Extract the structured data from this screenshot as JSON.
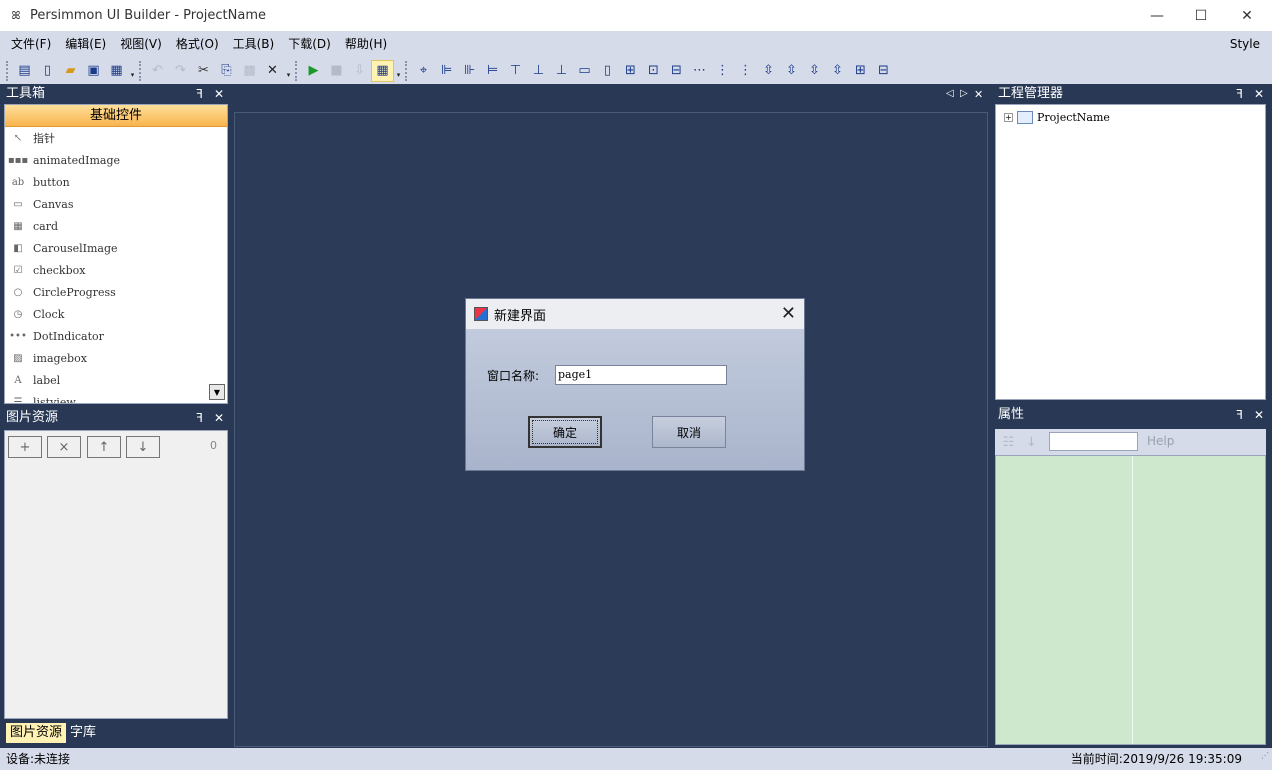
{
  "window": {
    "title": "Persimmon UI Builder - ProjectName",
    "app_icon_glyph": "ꕤ",
    "minimize_glyph": "—",
    "maximize_glyph": "☐",
    "close_glyph": "✕"
  },
  "menu": {
    "items": [
      "文件(F)",
      "编辑(E)",
      "视图(V)",
      "格式(O)",
      "工具(B)",
      "下载(D)",
      "帮助(H)"
    ],
    "style_label": "Style"
  },
  "toolbar": {
    "icons": {
      "new_page": "▤",
      "new_file": "▯",
      "open": "▰",
      "save": "▣",
      "save_all": "▦",
      "undo": "↶",
      "redo": "↷",
      "cut": "✂",
      "copy": "⎘",
      "paste": "▩",
      "delete": "✕",
      "run": "▶",
      "stop": "■",
      "download": "⇩",
      "grid": "▦",
      "drop": "▾"
    },
    "align_icons": [
      "⌖",
      "⊫",
      "⊪",
      "⊨",
      "⊤",
      "⊥",
      "⊥",
      "▭",
      "▯",
      "⊞",
      "⊡",
      "⊟",
      "⋯",
      "⋮",
      "⋮",
      "⇳",
      "⇳",
      "⇳",
      "⇳",
      "⊞",
      "⊟"
    ]
  },
  "toolbox": {
    "title": "工具箱",
    "pin_glyph": "ꟻ",
    "close_glyph": "✕",
    "header": "基础控件",
    "items": [
      {
        "label": "指针",
        "icon": "↖"
      },
      {
        "label": "animatedImage",
        "icon": "▪▪▪"
      },
      {
        "label": "button",
        "icon": "ab"
      },
      {
        "label": "Canvas",
        "icon": "▭"
      },
      {
        "label": "card",
        "icon": "▦"
      },
      {
        "label": "CarouselImage",
        "icon": "◧"
      },
      {
        "label": "checkbox",
        "icon": "☑"
      },
      {
        "label": "CircleProgress",
        "icon": "○"
      },
      {
        "label": "Clock",
        "icon": "◷"
      },
      {
        "label": "DotIndicator",
        "icon": "•••"
      },
      {
        "label": "imagebox",
        "icon": "▨"
      },
      {
        "label": "label",
        "icon": "A"
      },
      {
        "label": "listview",
        "icon": "☰"
      }
    ],
    "scroll_glyph": "▼"
  },
  "image_resources": {
    "title": "图片资源",
    "buttons": [
      "+",
      "×",
      "↑",
      "↓"
    ],
    "count": "0",
    "tabs": [
      "图片资源",
      "字库"
    ]
  },
  "document": {
    "nav_prev": "◁",
    "nav_next": "▷",
    "nav_close": "✕"
  },
  "dialog": {
    "title": "新建界面",
    "close_glyph": "✕",
    "name_label": "窗口名称:",
    "name_value": "page1",
    "ok_label": "确定",
    "cancel_label": "取消"
  },
  "project_manager": {
    "title": "工程管理器",
    "expand_glyph": "+",
    "root_node": "ProjectName"
  },
  "properties": {
    "title": "属性",
    "categorized_glyph": "☷",
    "sort_glyph": "↓",
    "help_label": "Help"
  },
  "status": {
    "device": "设备:未连接",
    "time": "当前时间:2019/9/26 19:35:09",
    "grip": "⋰"
  }
}
